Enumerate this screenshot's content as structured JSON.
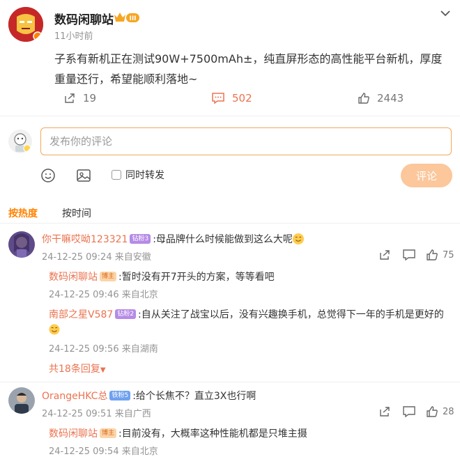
{
  "post": {
    "author": "数码闲聊站",
    "level_badge": "III",
    "time": "11小时前",
    "text": "子系有新机正在测试90W+7500mAh±，纯直屏形态的高性能平台新机，厚度重量还行，希望能顺利落地~",
    "reposts": "19",
    "comments": "502",
    "likes": "2443"
  },
  "composer": {
    "placeholder": "发布你的评论",
    "forward_label": "同时转发",
    "submit_label": "评论"
  },
  "sort": {
    "hot": "按热度",
    "time": "按时间"
  },
  "comments": [
    {
      "user": "你干嘛哎呦123321",
      "badge": "钻粉3",
      "text": ":母品牌什么时候能做到这么大呢",
      "meta": "24-12-25 09:24 来自安徽",
      "likes": "75",
      "replies": [
        {
          "user": "数码闲聊站",
          "badge": "博主",
          "text": ":暂时没有开7开头的方案，等等看吧",
          "meta": "24-12-25 09:46 来自北京"
        },
        {
          "user": "南部之星V587",
          "badge": "钻粉2",
          "text": ":自从关注了战宝以后，没有兴趣换手机，总觉得下一年的手机是更好的",
          "meta": "24-12-25 09:56 来自湖南"
        }
      ],
      "more_replies": "共18条回复"
    },
    {
      "user": "OrangeHKC总",
      "badge": "铁粉5",
      "text": ":给个长焦不？直立3X也行啊",
      "meta": "24-12-25 09:51 来自广西",
      "likes": "28",
      "replies": [
        {
          "user": "数码闲聊站",
          "badge": "博主",
          "text": ":目前没有，大概率这种性能机都是只堆主摄",
          "meta": "24-12-25 09:54 来自北京"
        }
      ]
    }
  ]
}
